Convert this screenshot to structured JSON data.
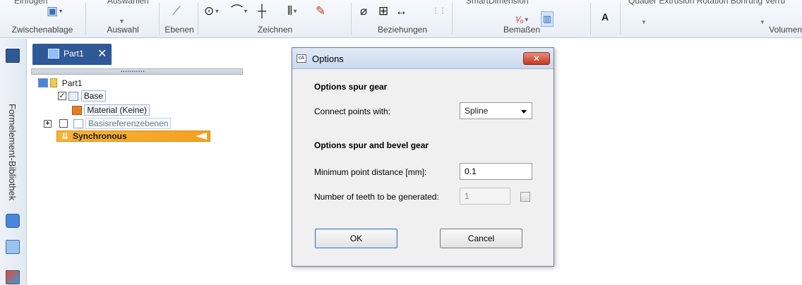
{
  "ribbon": {
    "groups": [
      {
        "label": "Zwischenablage",
        "top_text": "Einfügen"
      },
      {
        "label": "Auswahl",
        "top_text": "Auswählen"
      },
      {
        "label": "Ebenen"
      },
      {
        "label": "Zeichnen"
      },
      {
        "label": "Beziehungen"
      },
      {
        "label": "Bemaßen",
        "top_text": "SmartDimension"
      },
      {
        "label": "Volumenk",
        "top_text": "Quader  Extrusion  Rotation  Bohrung  Verru"
      }
    ]
  },
  "leftbar": {
    "library_label": "Formelement-Bibliothek"
  },
  "document": {
    "tab_label": "Part1",
    "close_glyph": "✕"
  },
  "tree": {
    "root": "Part1",
    "base": "Base",
    "material": "Material (Keine)",
    "refplanes": "Basisreferenzebenen",
    "synchronous": "Synchronous",
    "expand_glyph": "+",
    "check_glyph": "✓"
  },
  "dialog": {
    "title": "Options",
    "close_glyph": "✕",
    "section1_title": "Options spur gear",
    "connect_label": "Connect points with:",
    "connect_value": "Spline",
    "section2_title": "Options spur and bevel gear",
    "min_dist_label": "Minimum point distance [mm]:",
    "min_dist_value": "0.1",
    "teeth_label": "Number of teeth to be generated:",
    "teeth_value": "1",
    "ok_label": "OK",
    "cancel_label": "Cancel"
  },
  "colors": {
    "accent_tab": "#2f5897",
    "synchronous_highlight": "#f4a01f",
    "dialog_close": "#c33a22"
  }
}
